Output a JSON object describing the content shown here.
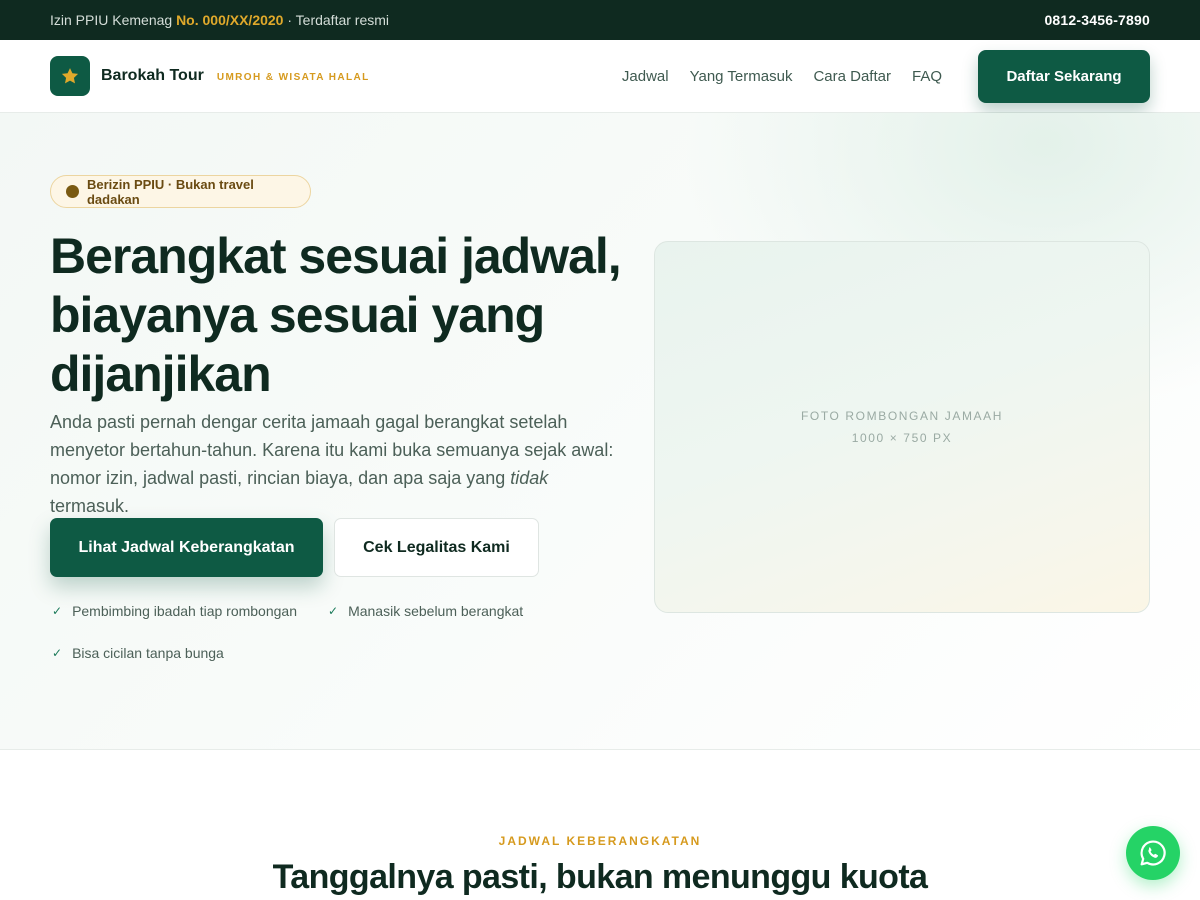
{
  "topbar": {
    "license_prefix": "Izin PPIU Kemenag",
    "license_number": "No. 000/XX/2020",
    "license_suffix": "· Terdaftar resmi",
    "phone": "0812-3456-7890"
  },
  "nav": {
    "brand_name": "Barokah Tour",
    "brand_tagline": "UMROH & WISATA HALAL",
    "links": [
      "Jadwal",
      "Yang Termasuk",
      "Cara Daftar",
      "FAQ"
    ],
    "cta_label": "Daftar Sekarang"
  },
  "hero": {
    "badge": "Berizin PPIU · Bukan travel dadakan",
    "title": "Berangkat sesuai jadwal, biayanya sesuai yang dijanjikan",
    "desc_before": "Anda pasti pernah dengar cerita jamaah gagal berangkat setelah menyetor bertahun-tahun. Karena itu kami buka semuanya sejak awal: nomor izin, jadwal pasti, rincian biaya, dan apa saja yang ",
    "desc_emphasis": "tidak",
    "desc_after": " termasuk.",
    "primary_button": "Lihat Jadwal Keberangkatan",
    "secondary_button": "Cek Legalitas Kami",
    "perks": [
      "Pembimbing ibadah tiap rombongan",
      "Manasik sebelum berangkat",
      "Bisa cicilan tanpa bunga"
    ],
    "photo_caption": "FOTO ROMBONGAN JAMAAH",
    "photo_size": "1000 × 750 PX"
  },
  "schedule": {
    "eyebrow": "JADWAL KEBERANGKATAN",
    "title": "Tanggalnya pasti, bukan menunggu kuota"
  },
  "colors": {
    "primary": "#0e5a44",
    "dark": "#0f2a20",
    "gold": "#d69a1e",
    "whatsapp": "#25d366"
  },
  "icons": {
    "brand": "star-icon",
    "perk": "check-icon",
    "badge": "dot-icon",
    "floating": "whatsapp-icon"
  }
}
